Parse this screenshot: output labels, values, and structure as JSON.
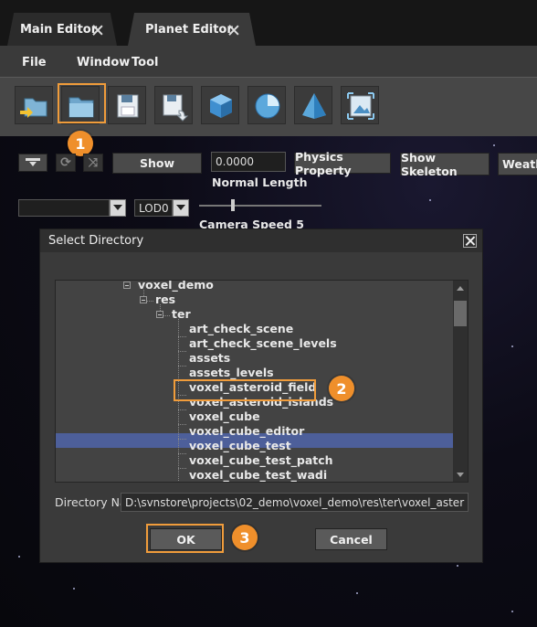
{
  "tabs": [
    {
      "label": "Main Editor"
    },
    {
      "label": "Planet Editor"
    }
  ],
  "menu": {
    "items": [
      "File",
      "Window",
      "Tool"
    ]
  },
  "toolbar": {
    "buttons": [
      "import-folder-icon",
      "open-folder-icon",
      "save-icon",
      "save-as-icon",
      "cube-icon",
      "sphere-icon",
      "pyramid-icon",
      "image-tool-icon"
    ]
  },
  "badges": [
    "1",
    "2",
    "3"
  ],
  "controls": {
    "show_label": "Show",
    "normal_length_value": "0.0000",
    "normal_length_label": "Normal Length",
    "physics_property_label": "Physics Property",
    "show_skeleton_label": "Show Skeleton",
    "weather_label": "Weathe",
    "lod_value": "LOD0",
    "camera_speed_label": "Camera Speed 5"
  },
  "dialog": {
    "title": "Select Directory",
    "tree": [
      {
        "label": "voxel_demo"
      },
      {
        "label": "res"
      },
      {
        "label": "ter"
      },
      {
        "label": "art_check_scene"
      },
      {
        "label": "art_check_scene_levels"
      },
      {
        "label": "assets"
      },
      {
        "label": "assets_levels"
      },
      {
        "label": "voxel_asteroid_field"
      },
      {
        "label": "voxel_asteroid_islands"
      },
      {
        "label": "voxel_cube"
      },
      {
        "label": "voxel_cube_editor"
      },
      {
        "label": "voxel_cube_test"
      },
      {
        "label": "voxel_cube_test_patch"
      },
      {
        "label": "voxel_cube_test_wadi"
      }
    ],
    "selected": "voxel_asteroid_field",
    "dir_label": "Directory Na",
    "dir_value": "D:\\svnstore\\projects\\02_demo\\voxel_demo\\res\\ter\\voxel_aster",
    "ok_label": "OK",
    "cancel_label": "Cancel"
  },
  "colors": {
    "highlight": "#f09c3b",
    "selection": "#4d5f9a",
    "badge": "#ef8f2b"
  }
}
